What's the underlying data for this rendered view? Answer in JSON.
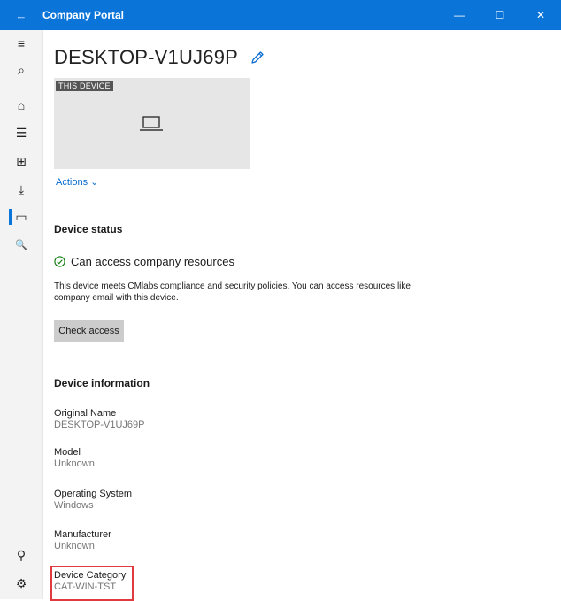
{
  "window": {
    "title": "Company Portal",
    "back_icon": "←",
    "minimize_icon": "—",
    "maximize_icon": "☐",
    "close_icon": "✕"
  },
  "sidebar": {
    "icons": [
      {
        "name": "menu-icon",
        "glyph": "≡"
      },
      {
        "name": "search-icon",
        "glyph": "⌕"
      },
      {
        "name": "home-icon",
        "glyph": "⌂"
      },
      {
        "name": "apps-list-icon",
        "glyph": "☰"
      },
      {
        "name": "categories-icon",
        "glyph": "⊞"
      },
      {
        "name": "downloads-icon",
        "glyph": "⤓"
      },
      {
        "name": "devices-icon",
        "glyph": "▭",
        "selected": true
      },
      {
        "name": "help-support-icon",
        "glyph": "🔍"
      }
    ],
    "bottom_icons": [
      {
        "name": "account-icon",
        "glyph": "⚲"
      },
      {
        "name": "settings-icon",
        "glyph": "⚙"
      }
    ]
  },
  "device": {
    "name": "DESKTOP-V1UJ69P",
    "tile_badge": "THIS DEVICE",
    "actions_label": "Actions ⌄"
  },
  "status": {
    "section_title": "Device status",
    "headline": "Can access company resources",
    "description": "This device meets CMlabs compliance and security policies. You can access resources like company email with this device.",
    "check_button": "Check access",
    "accent": "#107c10"
  },
  "info": {
    "section_title": "Device information",
    "items": [
      {
        "label": "Original Name",
        "value": "DESKTOP-V1UJ69P"
      },
      {
        "label": "Model",
        "value": "Unknown"
      },
      {
        "label": "Operating System",
        "value": "Windows"
      },
      {
        "label": "Manufacturer",
        "value": "Unknown"
      },
      {
        "label": "Device Category",
        "value": "CAT-WIN-TST"
      }
    ]
  },
  "colors": {
    "brand": "#0a74d9",
    "highlight": "#e0393e"
  }
}
